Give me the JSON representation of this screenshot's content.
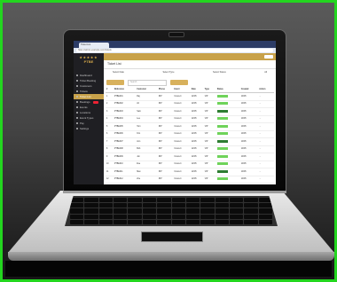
{
  "browser": {
    "tab_title": "Ticket List",
    "url": "https://admin.example.com/tickets"
  },
  "app": {
    "brand": "PTBE",
    "page_title": "Ticket List",
    "nav": [
      "Dashboard",
      "Ticket Booking",
      "Customers",
      "Tickets",
      "Ticket List",
      "Bookings",
      "Events",
      "Locations",
      "Event Types",
      "Pay",
      "Settings"
    ],
    "filters": [
      "Select Date",
      "Select Type",
      "Select Status",
      "All"
    ],
    "search_placeholder": "Search",
    "columns": [
      "#",
      "Reference",
      "Customer",
      "Phone",
      "Event",
      "Date",
      "Type",
      "Status",
      "Created",
      "Action"
    ],
    "rows": [
      [
        "1",
        "PTBE001",
        "Raj",
        "987",
        "Concert",
        "12/05",
        "VIP",
        "Paid",
        "10/05",
        "..."
      ],
      [
        "2",
        "PTBE002",
        "Ali",
        "987",
        "Concert",
        "12/05",
        "VIP",
        "Paid",
        "10/05",
        "..."
      ],
      [
        "3",
        "PTBE003",
        "Sam",
        "987",
        "Concert",
        "12/05",
        "VIP",
        "Paid",
        "10/05",
        "..."
      ],
      [
        "4",
        "PTBE004",
        "Lee",
        "987",
        "Concert",
        "12/05",
        "VIP",
        "Paid",
        "10/05",
        "..."
      ],
      [
        "5",
        "PTBE005",
        "Tom",
        "987",
        "Concert",
        "12/05",
        "VIP",
        "Paid",
        "10/05",
        "..."
      ],
      [
        "6",
        "PTBE006",
        "Kim",
        "987",
        "Concert",
        "12/05",
        "VIP",
        "Paid",
        "10/05",
        "..."
      ],
      [
        "7",
        "PTBE007",
        "Ann",
        "987",
        "Concert",
        "12/05",
        "VIP",
        "Paid",
        "10/05",
        "..."
      ],
      [
        "8",
        "PTBE008",
        "Bob",
        "987",
        "Concert",
        "12/05",
        "VIP",
        "Paid",
        "10/05",
        "..."
      ],
      [
        "9",
        "PTBE009",
        "Jon",
        "987",
        "Concert",
        "12/05",
        "VIP",
        "Paid",
        "10/05",
        "..."
      ],
      [
        "10",
        "PTBE010",
        "Eve",
        "987",
        "Concert",
        "12/05",
        "VIP",
        "Paid",
        "10/05",
        "..."
      ],
      [
        "11",
        "PTBE011",
        "Max",
        "987",
        "Concert",
        "12/05",
        "VIP",
        "Paid",
        "10/05",
        "..."
      ],
      [
        "12",
        "PTBE012",
        "Zoe",
        "987",
        "Concert",
        "12/05",
        "VIP",
        "Paid",
        "10/05",
        "..."
      ]
    ]
  },
  "colors": {
    "accent": "#c8a24a",
    "frame_border": "#23d61f",
    "status": "#6fd35a"
  }
}
